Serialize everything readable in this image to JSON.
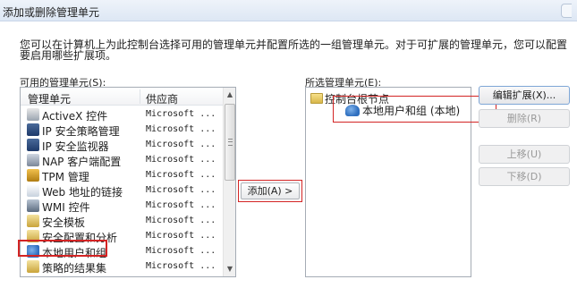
{
  "window": {
    "title": "添加或删除管理单元"
  },
  "description": "您可以在计算机上为此控制台选择可用的管理单元并配置所选的一组管理单元。对于可扩展的管理单元，您可以配置要启用哪些扩展项。",
  "available": {
    "label": "可用的管理单元(S):",
    "columns": [
      "管理单元",
      "供应商"
    ],
    "items": [
      {
        "name": "ActiveX 控件",
        "vendor": "Microsoft ...",
        "icon": "activex-icon"
      },
      {
        "name": "IP 安全策略管理",
        "vendor": "Microsoft ...",
        "icon": "ip-security-policy-icon"
      },
      {
        "name": "IP 安全监视器",
        "vendor": "Microsoft ...",
        "icon": "ip-security-monitor-icon"
      },
      {
        "name": "NAP 客户端配置",
        "vendor": "Microsoft ...",
        "icon": "nap-client-icon"
      },
      {
        "name": "TPM 管理",
        "vendor": "Microsoft ...",
        "icon": "tpm-icon"
      },
      {
        "name": "Web 地址的链接",
        "vendor": "Microsoft ...",
        "icon": "web-link-icon"
      },
      {
        "name": "WMI 控件",
        "vendor": "Microsoft ...",
        "icon": "wmi-icon"
      },
      {
        "name": "安全模板",
        "vendor": "Microsoft ...",
        "icon": "security-template-icon"
      },
      {
        "name": "安全配置和分析",
        "vendor": "Microsoft ...",
        "icon": "security-config-icon"
      },
      {
        "name": "本地用户和组",
        "vendor": "Microsoft ...",
        "icon": "local-users-icon"
      },
      {
        "name": "策略的结果集",
        "vendor": "Microsoft ...",
        "icon": "rsop-icon"
      }
    ]
  },
  "add_button": "添加(A) >",
  "selected": {
    "label": "所选管理单元(E):",
    "root": "控制台根节点",
    "child": "本地用户和组 (本地)"
  },
  "buttons": {
    "edit": "编辑扩展(X)...",
    "remove": "删除(R)",
    "move_up": "上移(U)",
    "move_down": "下移(D)"
  }
}
